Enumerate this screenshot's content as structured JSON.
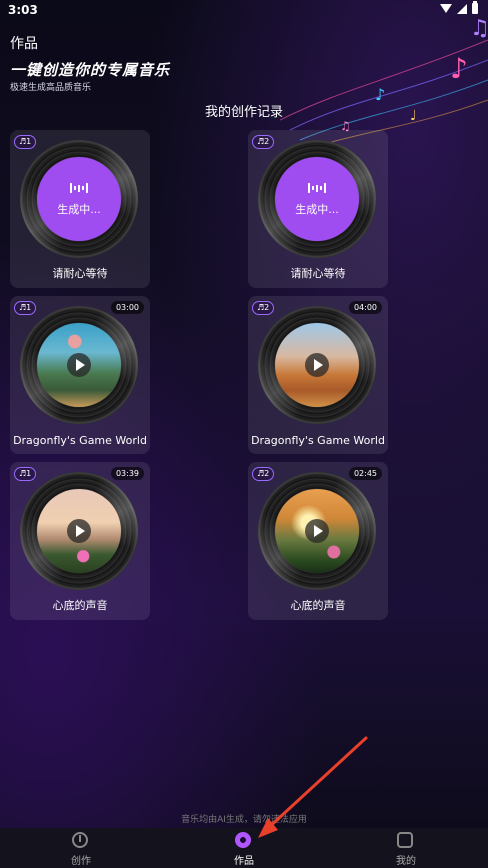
{
  "status": {
    "time": "3:03"
  },
  "header": {
    "page_title": "作品",
    "hero_title": "一键创造你的专属音乐",
    "hero_subtitle": "极速生成高品质音乐"
  },
  "section_title": "我的创作记录",
  "cards": [
    {
      "badge": "♬1",
      "state": "generating",
      "center_text": "生成中...",
      "label": "请耐心等待"
    },
    {
      "badge": "♬2",
      "state": "generating",
      "center_text": "生成中...",
      "label": "请耐心等待"
    },
    {
      "badge": "♬1",
      "duration": "03:00",
      "label": "Dragonfly's Game World",
      "art": "fantasy-landscape"
    },
    {
      "badge": "♬2",
      "duration": "04:00",
      "label": "Dragonfly's Game World",
      "art": "desert-landscape"
    },
    {
      "badge": "♬1",
      "duration": "03:39",
      "label": "心底的声音",
      "art": "pink-flowers"
    },
    {
      "badge": "♬2",
      "duration": "02:45",
      "label": "心底的声音",
      "art": "sunset-flowers"
    }
  ],
  "disclaimer": "音乐均由AI生成，请勿违法应用",
  "nav": [
    {
      "label": "创作",
      "icon": "create-icon"
    },
    {
      "label": "作品",
      "icon": "works-icon",
      "active": true
    },
    {
      "label": "我的",
      "icon": "robot-profile-icon"
    }
  ],
  "colors": {
    "accent": "#9f4cf0",
    "badge_border": "#9b6bff",
    "annotation_arrow": "#e8402a"
  }
}
